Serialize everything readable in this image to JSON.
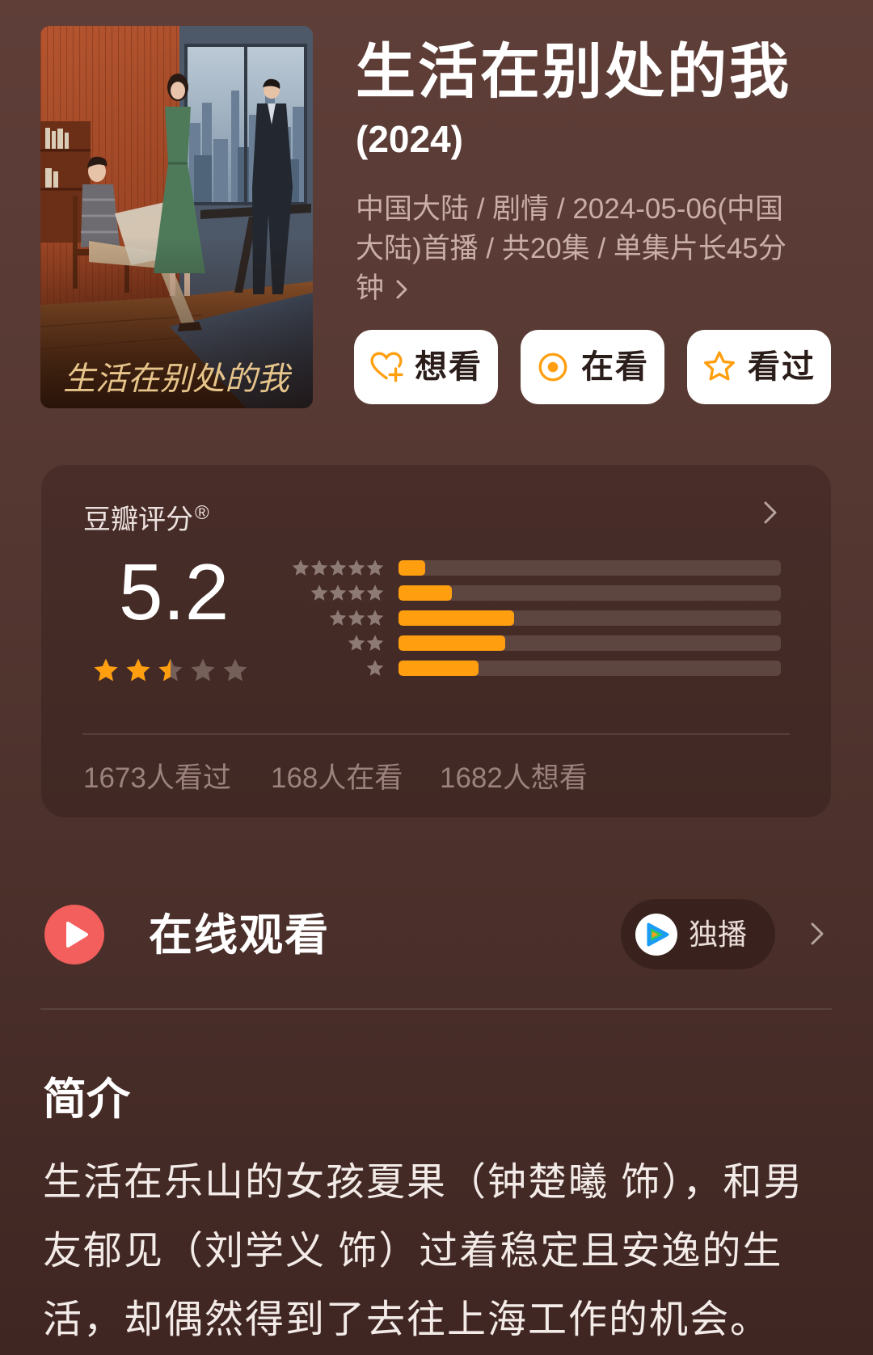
{
  "header": {
    "title": "生活在别处的我",
    "year": "(2024)",
    "meta": "中国大陆 / 剧情 / 2024-05-06(中国大陆)首播 / 共20集 / 单集片长45分钟",
    "meta_more_icon": "chevron-right-icon"
  },
  "poster": {
    "title_art": "生活在别处的我",
    "icon": "poster-image"
  },
  "actions": [
    {
      "label": "想看",
      "icon": "heart-plus-icon"
    },
    {
      "label": "在看",
      "icon": "target-icon"
    },
    {
      "label": "看过",
      "icon": "star-outline-icon"
    }
  ],
  "rating": {
    "source": "豆瓣评分",
    "registered_mark": "®",
    "more_icon": "chevron-right-icon",
    "score": "5.2",
    "stars_filled": 2.5,
    "stars_total": 5,
    "distribution": [
      {
        "stars": 5,
        "percent": 6.9
      },
      {
        "stars": 4,
        "percent": 14.0
      },
      {
        "stars": 3,
        "percent": 30.2
      },
      {
        "stars": 2,
        "percent": 27.9
      },
      {
        "stars": 1,
        "percent": 21.0
      }
    ],
    "stats": [
      "1673人看过",
      "168人在看",
      "1682人想看"
    ]
  },
  "watch": {
    "title": "在线观看",
    "badge": "独播",
    "play_icon": "play-circle-icon",
    "platform_icon": "tencent-video-icon",
    "more_icon": "chevron-right-icon"
  },
  "intro": {
    "heading": "简介",
    "text": "生活在乐山的女孩夏果（钟楚曦 饰），和男友郁见（刘学义 饰）过着稳定且安逸的生活，却偶然得到了去往上海工作的机会。"
  },
  "colors": {
    "accent": "#ff9f10",
    "play_red": "#f25f5c"
  }
}
